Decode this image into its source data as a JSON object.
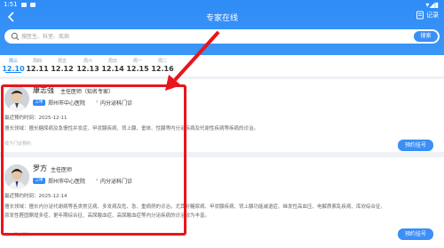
{
  "status_bar": {
    "time": "1:51"
  },
  "header": {
    "title": "专家在线",
    "record_label": "记录"
  },
  "search": {
    "placeholder": "搜医生、科室、疾病",
    "button_label": "搜索"
  },
  "dates": [
    {
      "weekday": "周三",
      "date": "12.10",
      "active": true
    },
    {
      "weekday": "周四",
      "date": "12.11"
    },
    {
      "weekday": "周五",
      "date": "12.12"
    },
    {
      "weekday": "周六",
      "date": "12.13"
    },
    {
      "weekday": "周日",
      "date": "12.14"
    },
    {
      "weekday": "周一",
      "date": "12.15"
    },
    {
      "weekday": "周二",
      "date": "12.16"
    }
  ],
  "doctors": [
    {
      "name": "康志强",
      "title": "主任医师（知名专家）",
      "badge": "三甲",
      "hospital": "郑州市中心医院",
      "department": "内分泌科门诊",
      "recent_label": "最近预约时间：",
      "recent_date": "2025-12-11",
      "specialty_label": "擅长领域：",
      "specialty": "擅长糖尿病及急慢性并发症、甲状腺疾病、肾上腺、垂体、性腺等内分泌疾病及代谢性疾病等疾病的诊治。",
      "clinic": "线下门诊预约",
      "book_label": "预约挂号"
    },
    {
      "name": "罗方",
      "title": "主任医师",
      "badge": "三甲",
      "hospital": "郑州市中心医院",
      "department": "内分泌科门诊",
      "recent_label": "最近预约时间：",
      "recent_date": "2025-12-14",
      "specialty_label": "擅长领域：",
      "specialty_line1": "擅长内分泌代谢病等各类常见病、多发病及危、急、重病例的诊治，尤其对糖尿病、甲状腺疾病、肾上腺功能减退症、继发性高血压、电解质紊乱疾病、库欣综合征、",
      "specialty_line2": "原发性醛固酮增多症、更年期综合征、高尿酸血症、高尿酸血症等内分泌疾病的诊治较为丰富。",
      "clinic": "线下门诊预约",
      "book_label": "预约挂号"
    }
  ],
  "colors": {
    "header_blue": "#2f8cf6",
    "accent_blue": "#1a88f4",
    "highlight_red": "#e8151c"
  }
}
